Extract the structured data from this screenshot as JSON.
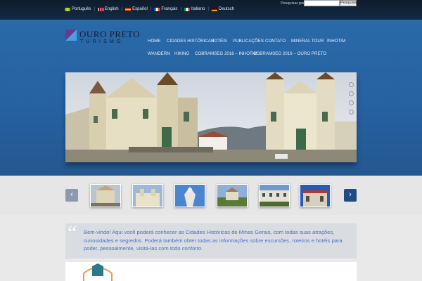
{
  "languages": [
    {
      "label": "Português",
      "flag": "brazil-flag-icon"
    },
    {
      "label": "English",
      "flag": "uk-flag-icon"
    },
    {
      "label": "Español",
      "flag": "spain-flag-icon"
    },
    {
      "label": "Français",
      "flag": "france-flag-icon"
    },
    {
      "label": "Italiano",
      "flag": "italy-flag-icon"
    },
    {
      "label": "Deutsch",
      "flag": "germany-flag-icon"
    }
  ],
  "search": {
    "label": "Pesquisar por:",
    "value": "",
    "button": "Pesquisar"
  },
  "logo": {
    "title": "OURO PRETO",
    "subtitle": "TURISMO"
  },
  "nav": {
    "items": [
      "HOME",
      "CIDADES HISTÓRICAS",
      "HOTÉIS",
      "PUBLICAÇÕES",
      "CONTATO",
      "MINERAL TOUR",
      "INHOTIM",
      "WANDERN",
      "HIKING",
      "COBRAMSEG 2016 – INHOTIM",
      "COBRAMSEG 2016 – OURO PRETO"
    ]
  },
  "slider": {
    "slide_count": 4,
    "active_slide": 1
  },
  "carousel": {
    "prev_icon": "chevron-left-icon",
    "next_icon": "chevron-right-icon",
    "thumb_count": 6
  },
  "welcome": {
    "text": "Bem-vindo! Aqui você poderá conhecer as Cidades Históricas de Minas Gerais, com todas suas atrações, curiosidades e segredos. Poderá também obter todas as informações sobre excursões, roteiros e hotéis para poder, pessoalmente, visitá-las com todo conforto."
  },
  "colors": {
    "header_blue": "#2a6aa8",
    "topbar": "#0e1c2c",
    "accent_text": "#4d6fc4"
  }
}
